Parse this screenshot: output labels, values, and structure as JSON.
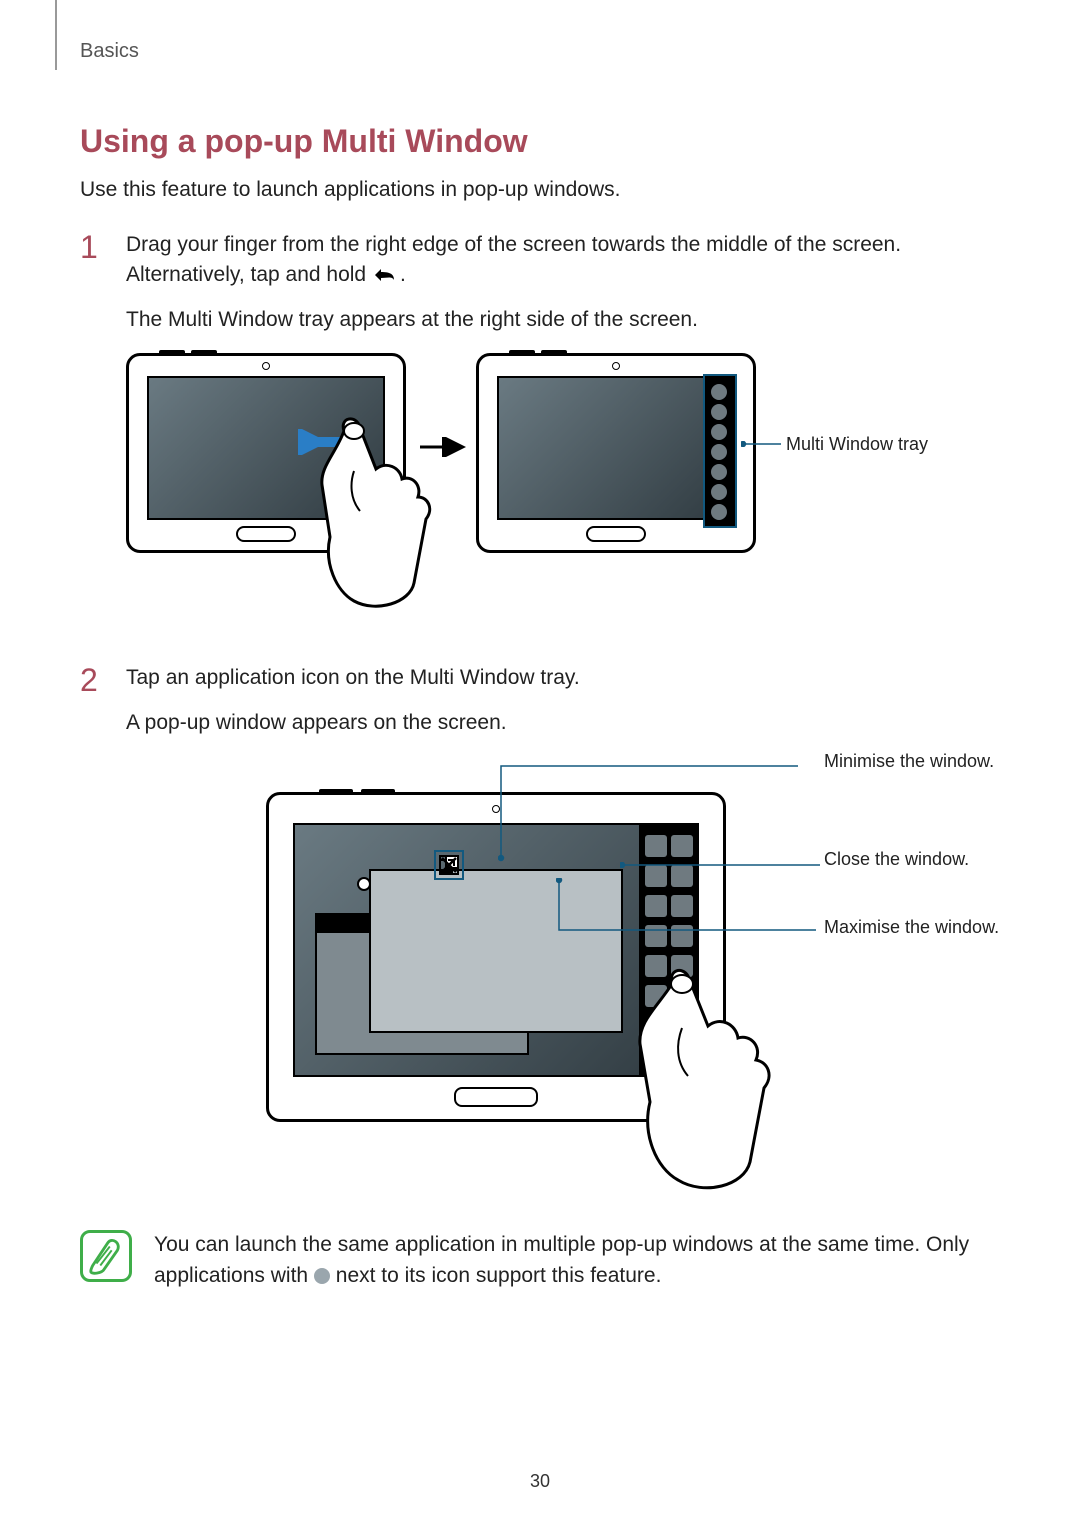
{
  "running_head": "Basics",
  "title": "Using a pop-up Multi Window",
  "intro": "Use this feature to launch applications in pop-up windows.",
  "steps": {
    "s1": {
      "num": "1",
      "p1a": "Drag your finger from the right edge of the screen towards the middle of the screen. Alternatively, tap and hold ",
      "p1b": ".",
      "p2": "The Multi Window tray appears at the right side of the screen."
    },
    "s2": {
      "num": "2",
      "p1": "Tap an application icon on the Multi Window tray.",
      "p2": "A pop-up window appears on the screen."
    }
  },
  "callouts": {
    "tray": "Multi Window tray",
    "minimise": "Minimise the window.",
    "close": "Close the window.",
    "maximise": "Maximise the window."
  },
  "note": {
    "text_a": "You can launch the same application in multiple pop-up windows at the same time. Only applications with ",
    "text_b": " next to its icon support this feature."
  },
  "page_number": "30"
}
